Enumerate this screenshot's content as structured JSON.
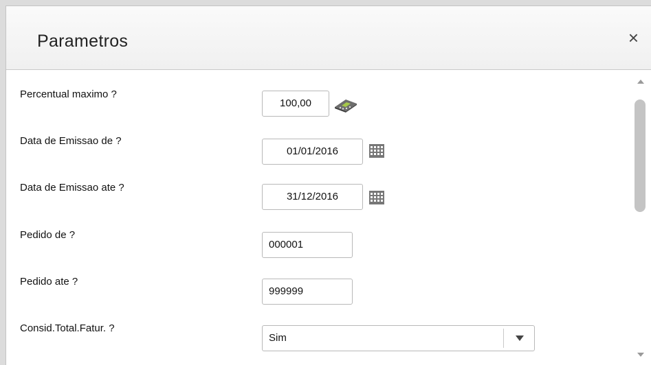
{
  "dialog": {
    "title": "Parametros",
    "close_label": "×"
  },
  "params": [
    {
      "label": "Percentual maximo ?",
      "value": "100,00",
      "icon": "calculator-icon"
    },
    {
      "label": "Data de Emissao de ?",
      "value": "01/01/2016",
      "icon": "calendar-icon"
    },
    {
      "label": "Data de Emissao ate ?",
      "value": "31/12/2016",
      "icon": "calendar-icon"
    },
    {
      "label": "Pedido de ?",
      "value": "000001"
    },
    {
      "label": "Pedido ate ?",
      "value": "999999"
    },
    {
      "label": "Consid.Total.Fatur. ?",
      "value": "Sim",
      "icon": "chevron-down-icon"
    }
  ]
}
